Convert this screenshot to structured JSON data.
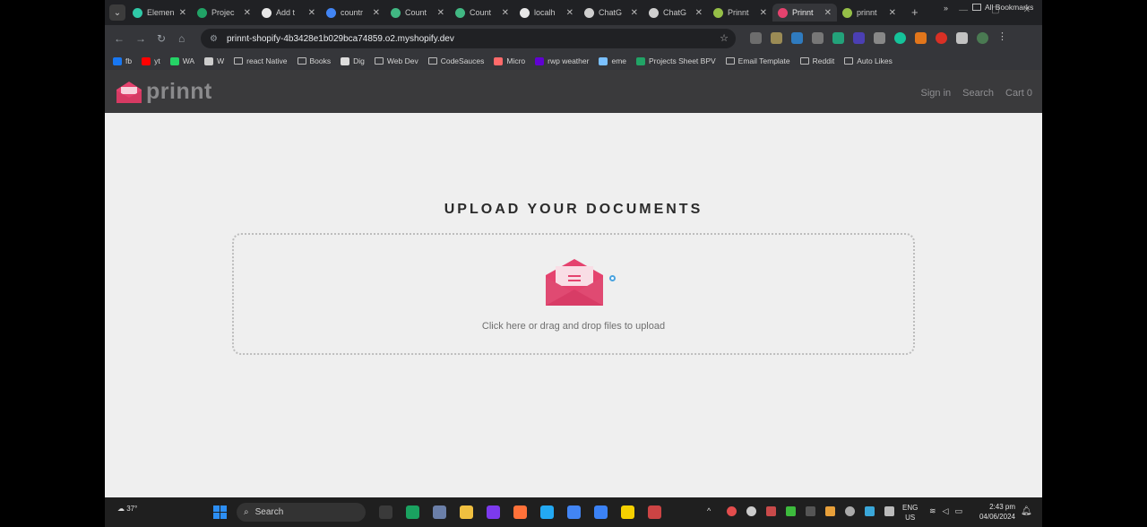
{
  "browser": {
    "tabs": [
      {
        "label": "Elemen",
        "color": "#2fc9a7"
      },
      {
        "label": "Projec",
        "color": "#21a366"
      },
      {
        "label": "Add t",
        "color": "#e8e8e8"
      },
      {
        "label": "countr",
        "color": "#4285f4"
      },
      {
        "label": "Count",
        "color": "#41b883"
      },
      {
        "label": "Count",
        "color": "#41b883"
      },
      {
        "label": "localh",
        "color": "#e8e8e8"
      },
      {
        "label": "ChatG",
        "color": "#cfcfcf"
      },
      {
        "label": "ChatG",
        "color": "#cfcfcf"
      },
      {
        "label": "Prinnt",
        "color": "#95bf47"
      },
      {
        "label": "Prinnt",
        "color": "#e5426e",
        "active": true
      },
      {
        "label": "prinnt",
        "color": "#95bf47"
      }
    ],
    "new_tab": "+",
    "url": "prinnt-shopify-4b3428e1b029bca74859.o2.myshopify.dev",
    "bookmarks": [
      {
        "label": "fb",
        "color": "#1877f2"
      },
      {
        "label": "yt",
        "color": "#ff0000"
      },
      {
        "label": "WA",
        "color": "#25d366"
      },
      {
        "label": "W",
        "color": "#cccccc"
      },
      {
        "label": "react Native",
        "folder": true
      },
      {
        "label": "Books",
        "folder": true
      },
      {
        "label": "Dig",
        "color": "#dddddd"
      },
      {
        "label": "Web Dev",
        "folder": true
      },
      {
        "label": "CodeSauces",
        "folder": true
      },
      {
        "label": "Micro",
        "color": "#ff6a6a"
      },
      {
        "label": "rwp weather",
        "color": "#6001d2"
      },
      {
        "label": "eme",
        "color": "#7ac0ff"
      },
      {
        "label": "Projects Sheet BPV",
        "color": "#21a366"
      },
      {
        "label": "Email Template",
        "folder": true
      },
      {
        "label": "Reddit",
        "folder": true
      },
      {
        "label": "Auto Likes",
        "folder": true
      }
    ],
    "all_bookmarks": "All Bookmarks"
  },
  "site": {
    "logo": "prinnt",
    "nav": {
      "signin": "Sign in",
      "search": "Search",
      "cart": "Cart 0"
    },
    "accent": "#e5426e"
  },
  "upload": {
    "title": "UPLOAD YOUR DOCUMENTS",
    "hint": "Click here or drag and drop files to upload"
  },
  "taskbar": {
    "weather": "37°",
    "search": "Search",
    "lang": "ENG",
    "region": "US",
    "time": "2:43 pm",
    "date": "04/06/2024",
    "apps": [
      "#3a3a3a",
      "#1aa260",
      "#6b7fa8",
      "#f0c040",
      "#7c3aed",
      "#ff7139",
      "#23a9f2",
      "#4285f4",
      "#3b82f6",
      "#f5d000",
      "#cc4444"
    ]
  }
}
